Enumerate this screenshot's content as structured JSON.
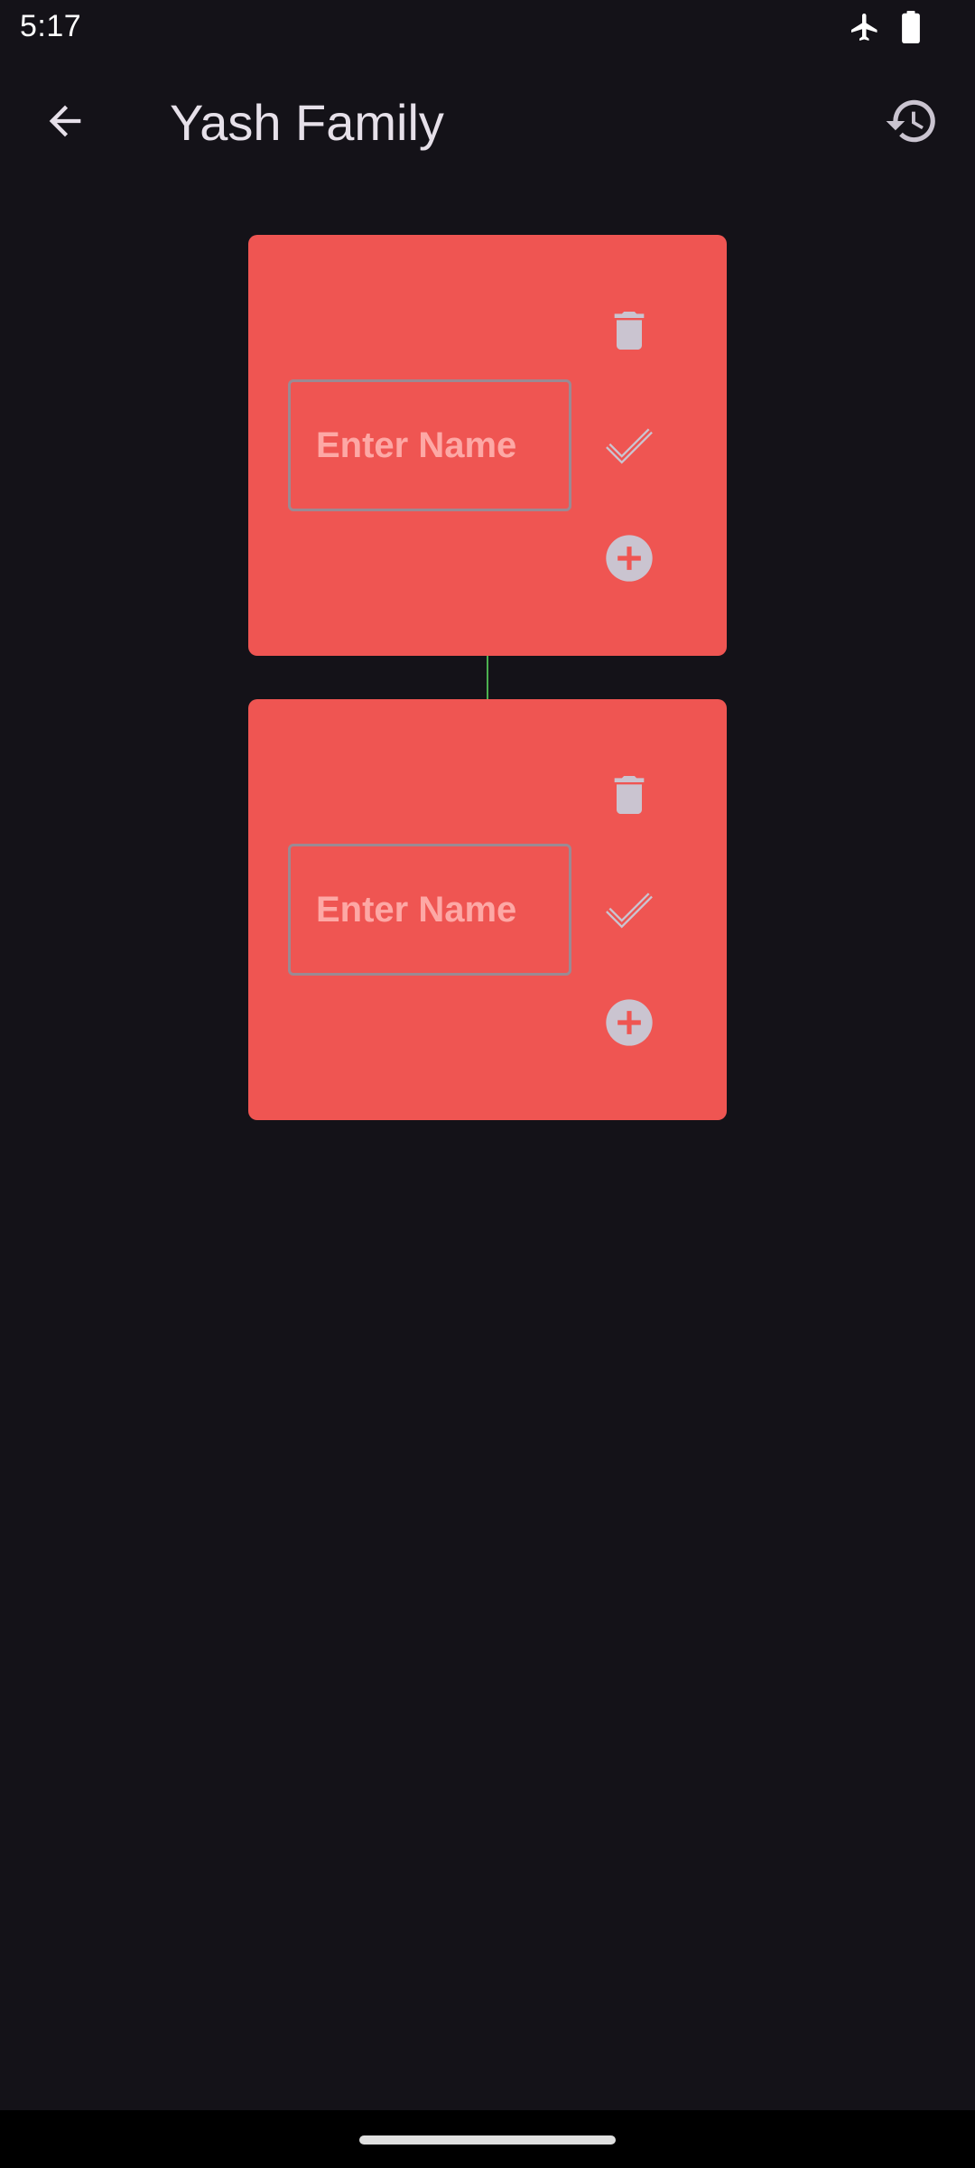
{
  "status_bar": {
    "time": "5:17",
    "icons": [
      "airplane-mode-icon",
      "battery-icon"
    ]
  },
  "app_bar": {
    "title": "Yash Family",
    "back_icon": "arrow-back-icon",
    "history_icon": "history-icon"
  },
  "nodes": [
    {
      "name_value": "",
      "name_placeholder": "Enter Name",
      "actions": [
        "delete-icon",
        "check-icon",
        "add-circle-icon"
      ]
    },
    {
      "name_value": "",
      "name_placeholder": "Enter Name",
      "actions": [
        "delete-icon",
        "check-icon",
        "add-circle-icon"
      ]
    }
  ],
  "colors": {
    "background": "#141218",
    "card": "#EF5552",
    "connector": "#4CAF50",
    "icon": "#CAC4D0",
    "placeholder": "#FDA8A5"
  }
}
